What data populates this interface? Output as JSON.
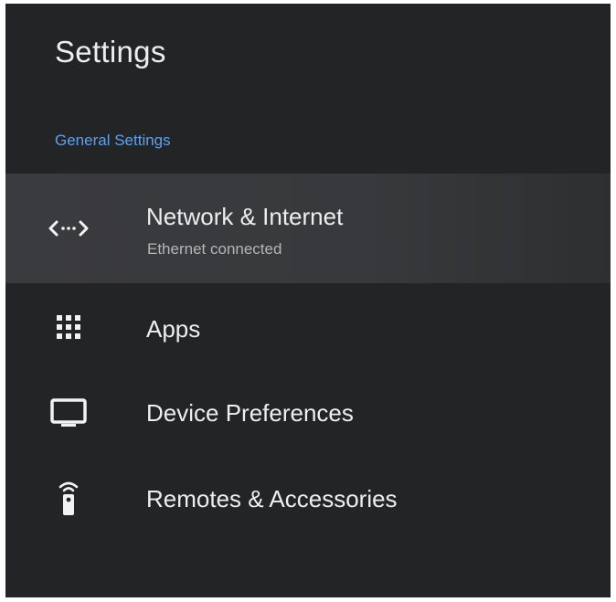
{
  "header": {
    "title": "Settings"
  },
  "section": {
    "label": "General Settings"
  },
  "colors": {
    "background": "#232426",
    "accent": "#5fa0ec",
    "focused_row": "#3a3b3e",
    "text_primary": "#eeeeee",
    "text_secondary": "#b5b5b5"
  },
  "menu": {
    "items": [
      {
        "label": "Network & Internet",
        "subtitle": "Ethernet connected",
        "icon": "network-icon",
        "focused": true
      },
      {
        "label": "Apps",
        "icon": "apps-grid-icon",
        "focused": false
      },
      {
        "label": "Device Preferences",
        "icon": "tv-icon",
        "focused": false
      },
      {
        "label": "Remotes & Accessories",
        "icon": "remote-icon",
        "focused": false
      }
    ]
  }
}
